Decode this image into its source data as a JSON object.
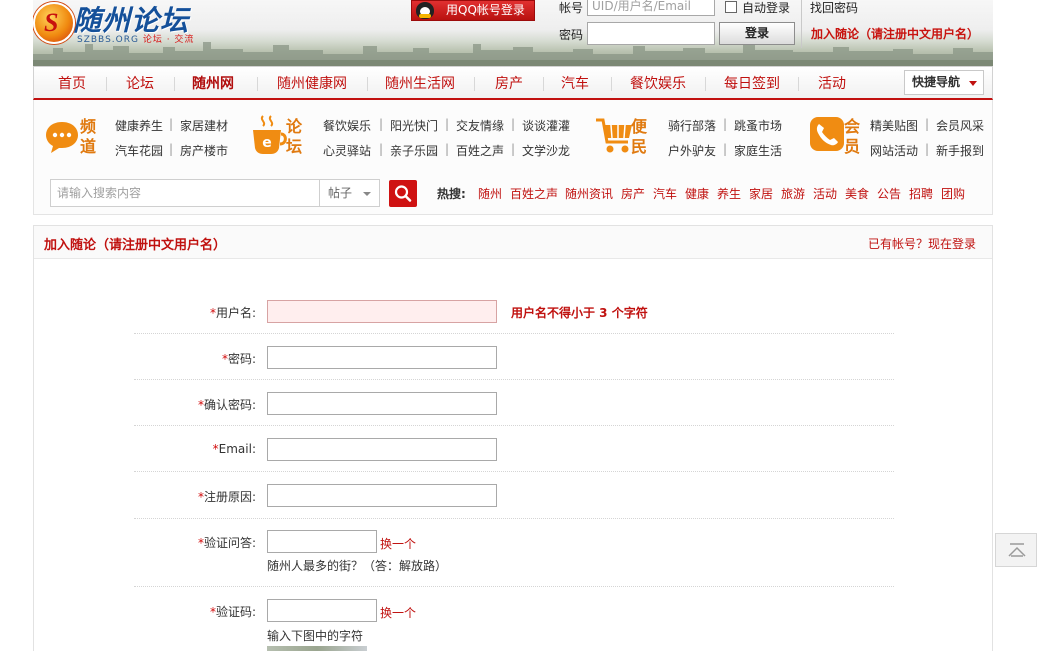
{
  "header": {
    "logo_title": "随州论坛",
    "logo_domain": "SZBBS.ORG",
    "logo_tag": "论坛 · 交流",
    "qq_login_label": "用QQ帐号登录",
    "account_label": "帐号",
    "account_placeholder": "UID/用户名/Email",
    "auto_login_label": "自动登录",
    "forgot_password_label": "找回密码",
    "password_label": "密码",
    "login_button": "登录",
    "register_link": "加入随论（请注册中文用户名）"
  },
  "nav": {
    "items": [
      "首页",
      "论坛",
      "随州网",
      "随州健康网",
      "随州生活网",
      "房产",
      "汽车",
      "餐饮娱乐",
      "每日签到",
      "活动"
    ],
    "quick_nav_label": "快捷导航"
  },
  "categories": [
    {
      "title": "频道",
      "icon": "chat-bubble-icon",
      "row1": [
        "健康养生",
        "家居建材"
      ],
      "row2": [
        "汽车花园",
        "房产楼市"
      ]
    },
    {
      "title": "论坛",
      "icon": "coffee-cup-icon",
      "row1": [
        "餐饮娱乐",
        "阳光快门",
        "交友情缘",
        "谈谈灌灌"
      ],
      "row2": [
        "心灵驿站",
        "亲子乐园",
        "百姓之声",
        "文学沙龙"
      ]
    },
    {
      "title": "便民",
      "icon": "shopping-cart-icon",
      "row1": [
        "骑行部落",
        "跳蚤市场"
      ],
      "row2": [
        "户外驴友",
        "家庭生活"
      ]
    },
    {
      "title": "会员",
      "icon": "phone-icon",
      "row1": [
        "精美贴图",
        "会员风采"
      ],
      "row2": [
        "网站活动",
        "新手报到"
      ]
    }
  ],
  "search": {
    "placeholder": "请输入搜索内容",
    "type_selected": "帖子",
    "hot_label": "热搜:",
    "hot_terms": [
      "随州",
      "百姓之声",
      "随州资讯",
      "房产",
      "汽车",
      "健康",
      "养生",
      "家居",
      "旅游",
      "活动",
      "美食",
      "公告",
      "招聘",
      "团购"
    ]
  },
  "register": {
    "title": "加入随论（请注册中文用户名）",
    "login_link": "已有帐号？现在登录",
    "fields": {
      "username": "用户名:",
      "password": "密码:",
      "confirm_password": "确认密码:",
      "email": "Email:",
      "reason": "注册原因:",
      "question": "验证问答:",
      "captcha": "验证码:"
    },
    "required_mark": "*",
    "username_error": "用户名不得小于  3 个字符",
    "swap_label": "换一个",
    "question_text": "随州人最多的街？（答：解放路）",
    "captcha_hint": "输入下图中的字符"
  },
  "colors": {
    "brand_red": "#c0110f",
    "logo_blue": "#14509a",
    "category_orange": "#e07a10"
  }
}
